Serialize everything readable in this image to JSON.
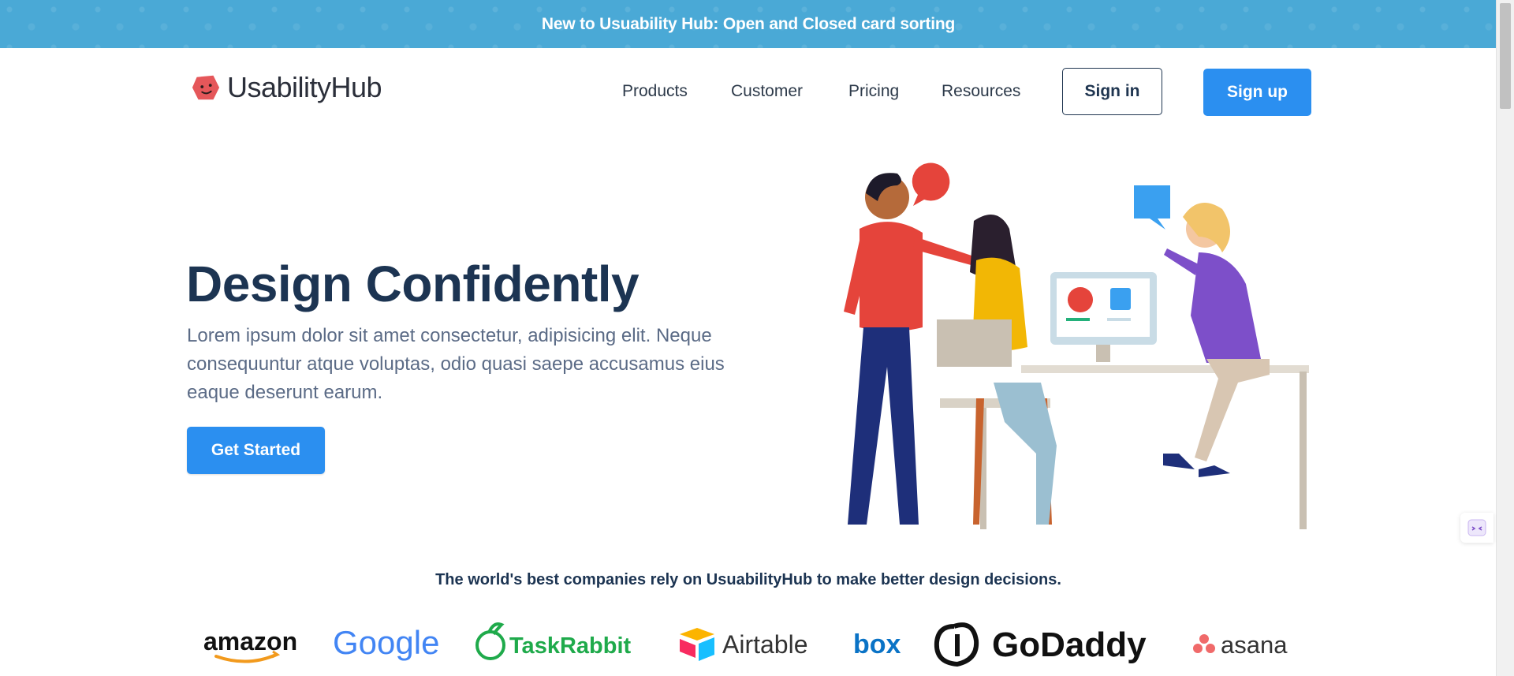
{
  "announcement": {
    "text": "New to Usuability Hub: Open and Closed card sorting"
  },
  "header": {
    "logo_text": "UsabilityHub",
    "nav": [
      "Products",
      "Customer",
      "Pricing",
      "Resources"
    ],
    "signin_label": "Sign in",
    "signup_label": "Sign up"
  },
  "hero": {
    "title": "Design Confidently",
    "text": "Lorem ipsum dolor sit amet consectetur, adipisicing elit. Neque consequuntur atque voluptas, odio quasi saepe accusamus eius eaque deserunt earum.",
    "cta_label": "Get Started"
  },
  "trusted": {
    "text": "The world's best companies rely on UsuabilityHub to make better design decisions.",
    "logos": [
      "amazon",
      "Google",
      "TaskRabbit",
      "Airtable",
      "box",
      "GoDaddy",
      "asana"
    ]
  },
  "colors": {
    "announcement_bg": "#4aa9d6",
    "primary": "#2b8ff0",
    "heading": "#1c3452",
    "body_text": "#5b6b86"
  }
}
